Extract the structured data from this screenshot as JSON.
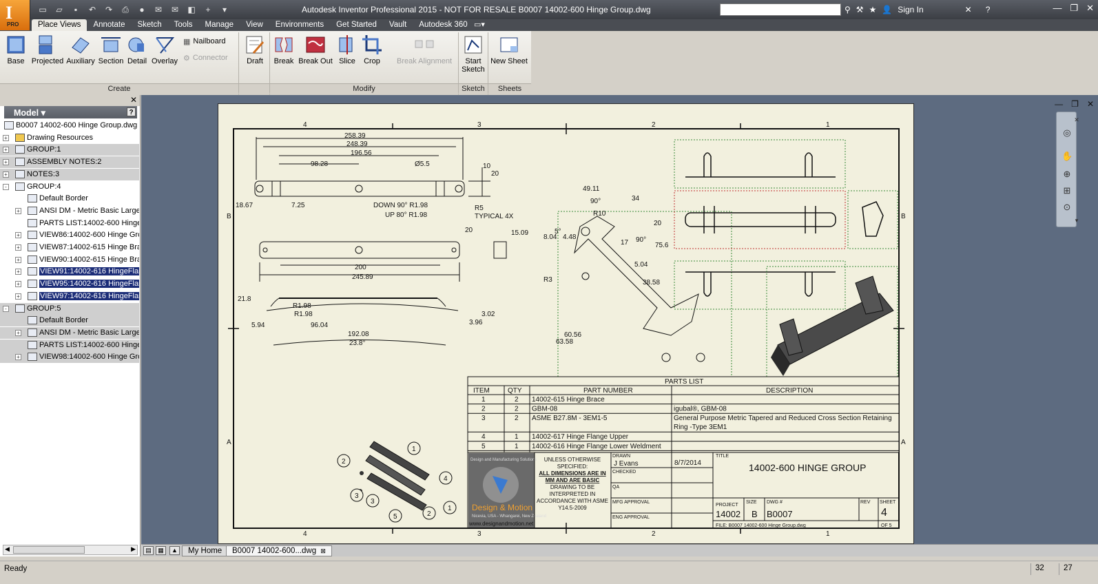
{
  "titlebar": {
    "title": "Autodesk Inventor Professional 2015 - NOT FOR RESALE    B0007 14002-600 Hinge Group.dwg",
    "app_badge": "PRO",
    "sign_in": "Sign In",
    "help": "?"
  },
  "tabs": [
    "Place Views",
    "Annotate",
    "Sketch",
    "Tools",
    "Manage",
    "View",
    "Environments",
    "Get Started",
    "Vault",
    "Autodesk 360"
  ],
  "ribbon": {
    "create": {
      "label": "Create",
      "buttons": [
        "Base",
        "Projected",
        "Auxiliary",
        "Section",
        "Detail",
        "Overlay"
      ],
      "small": [
        "Nailboard",
        "Connector"
      ]
    },
    "draft": "Draft",
    "modify": {
      "label": "Modify",
      "buttons": [
        "Break",
        "Break Out",
        "Slice",
        "Crop"
      ],
      "break_alignment": "Break Alignment"
    },
    "sketch": {
      "label": "Sketch",
      "button_line1": "Start",
      "button_line2": "Sketch"
    },
    "sheets": {
      "label": "Sheets",
      "button": "New Sheet"
    }
  },
  "browser": {
    "header": "Model",
    "items": [
      {
        "label": "B0007 14002-600 Hinge Group.dwg",
        "level": 0,
        "expander": "",
        "grey": false,
        "selected": false,
        "icon": "drawing-file-icon"
      },
      {
        "label": "Drawing Resources",
        "level": 1,
        "expander": "+",
        "grey": false,
        "selected": false,
        "icon": "folder-icon"
      },
      {
        "label": "GROUP:1",
        "level": 1,
        "expander": "+",
        "grey": true,
        "selected": false,
        "icon": "group-icon"
      },
      {
        "label": "ASSEMBLY NOTES:2",
        "level": 1,
        "expander": "+",
        "grey": true,
        "selected": false,
        "icon": "group-icon"
      },
      {
        "label": "NOTES:3",
        "level": 1,
        "expander": "+",
        "grey": true,
        "selected": false,
        "icon": "group-icon"
      },
      {
        "label": "GROUP:4",
        "level": 1,
        "expander": "-",
        "grey": false,
        "selected": false,
        "icon": "group-icon"
      },
      {
        "label": "Default Border",
        "level": 2,
        "expander": "",
        "grey": false,
        "selected": false,
        "icon": "border-icon"
      },
      {
        "label": "ANSI DM - Metric Basic Large",
        "level": 2,
        "expander": "+",
        "grey": false,
        "selected": false,
        "icon": "title-block-icon"
      },
      {
        "label": "PARTS LIST:14002-600 Hinge",
        "level": 2,
        "expander": "",
        "grey": false,
        "selected": false,
        "icon": "parts-list-icon"
      },
      {
        "label": "VIEW86:14002-600 Hinge Gro",
        "level": 2,
        "expander": "+",
        "grey": false,
        "selected": false,
        "icon": "view-icon"
      },
      {
        "label": "VIEW87:14002-615 Hinge Bra",
        "level": 2,
        "expander": "+",
        "grey": false,
        "selected": false,
        "icon": "view-icon"
      },
      {
        "label": "VIEW90:14002-615 Hinge Bra",
        "level": 2,
        "expander": "+",
        "grey": false,
        "selected": false,
        "icon": "view-icon"
      },
      {
        "label": "VIEW91:14002-616 HingeFlan",
        "level": 2,
        "expander": "+",
        "grey": false,
        "selected": true,
        "icon": "view-icon"
      },
      {
        "label": "VIEW95:14002-616 HingeFlan",
        "level": 2,
        "expander": "+",
        "grey": false,
        "selected": true,
        "icon": "view-icon"
      },
      {
        "label": "VIEW97:14002-616 HingeFlan",
        "level": 2,
        "expander": "+",
        "grey": false,
        "selected": true,
        "icon": "view-icon"
      },
      {
        "label": "GROUP:5",
        "level": 1,
        "expander": "-",
        "grey": true,
        "selected": false,
        "icon": "group-icon"
      },
      {
        "label": "Default Border",
        "level": 2,
        "expander": "",
        "grey": true,
        "selected": false,
        "icon": "border-icon"
      },
      {
        "label": "ANSI DM - Metric Basic Large",
        "level": 2,
        "expander": "+",
        "grey": true,
        "selected": false,
        "icon": "title-block-icon"
      },
      {
        "label": "PARTS LIST:14002-600 Hinge",
        "level": 2,
        "expander": "",
        "grey": true,
        "selected": false,
        "icon": "parts-list-icon"
      },
      {
        "label": "VIEW98:14002-600 Hinge Gro",
        "level": 2,
        "expander": "+",
        "grey": true,
        "selected": false,
        "icon": "view-icon"
      }
    ]
  },
  "drawing": {
    "zone_cols": [
      "4",
      "3",
      "2",
      "1"
    ],
    "zone_rows": [
      "B",
      "A"
    ],
    "dims_top": [
      "258.39",
      "248.39",
      "196.56",
      "98.28",
      "Ø5.5",
      "10",
      "20",
      "18.67",
      "7.25",
      "DOWN 90° R1.98",
      "UP 80° R1.98",
      "R5",
      "TYPICAL 4X"
    ],
    "dims_mid": [
      "200",
      "245.89",
      "20",
      "15.09"
    ],
    "dims_low": [
      "21.8",
      "R1.98",
      "R1.98",
      "5.94",
      "96.04",
      "192.08",
      "23.8°",
      "3.02",
      "3.96"
    ],
    "dims_brace": [
      "49.11",
      "90°",
      "R10",
      "34",
      "20",
      "5°",
      "8.04",
      "4.48",
      "17",
      "90°",
      "75.6",
      "5.04",
      "38.58",
      "R3",
      "60.56",
      "63.58"
    ],
    "parts_list": {
      "title": "PARTS LIST",
      "headers": [
        "ITEM",
        "QTY",
        "PART NUMBER",
        "DESCRIPTION"
      ],
      "rows": [
        {
          "item": "1",
          "qty": "2",
          "part": "14002-615 Hinge Brace",
          "desc1": "",
          "desc2": ""
        },
        {
          "item": "2",
          "qty": "2",
          "part": "GBM-08",
          "desc1": "igubal®, GBM-08",
          "desc2": ""
        },
        {
          "item": "3",
          "qty": "2",
          "part": "ASME B27.8M - 3EM1-5",
          "desc1": "General Purpose Metric Tapered and Reduced Cross Section Retaining",
          "desc2": "Ring -Type 3EM1"
        },
        {
          "item": "4",
          "qty": "1",
          "part": "14002-617 Hinge Flange Upper",
          "desc1": "",
          "desc2": ""
        },
        {
          "item": "5",
          "qty": "1",
          "part": "14002-616 Hinge Flange Lower Weldment",
          "desc1": "",
          "desc2": ""
        }
      ]
    },
    "balloons": [
      "1",
      "2",
      "3",
      "3",
      "4",
      "5",
      "2",
      "1"
    ],
    "title_block": {
      "logo_text": "Design & Motion",
      "logo_url": "www.designandmotion.net",
      "logo_top": "Design and Manufacturing Solutions",
      "logo_sub": "Nicevia, USA - Whangarei, New Zealand",
      "notes": [
        "UNLESS OTHERWISE",
        "SPECIFIED:",
        "ALL DIMENSIONS ARE IN",
        "MM AND ARE BASIC",
        "DRAWING TO BE",
        "INTERPRETED IN",
        "ACCORDANCE WITH ASME",
        "Y14.5-2009"
      ],
      "drawn_label": "DRAWN",
      "drawn_by": "J Evans",
      "drawn_date": "8/7/2014",
      "checked_label": "CHECKED",
      "qa_label": "QA",
      "mfg_label": "MFG APPROVAL",
      "eng_label": "ENG APPROVAL",
      "title_label": "TITLE",
      "title": "14002-600 HINGE GROUP",
      "project_label": "PROJECT",
      "project": "14002",
      "size_label": "SIZE",
      "size": "B",
      "dwg_label": "DWG #",
      "dwg": "B0007",
      "rev_label": "REV",
      "sheet_label": "SHEET",
      "sheet": "4",
      "of": "OF 5",
      "file": "FILE:  B0007 14002-600 Hinge Group.dwg"
    }
  },
  "doc_tabs": {
    "home": "My Home",
    "active": "B0007 14002-600...dwg"
  },
  "status": {
    "text": "Ready",
    "n1": "32",
    "n2": "27"
  }
}
